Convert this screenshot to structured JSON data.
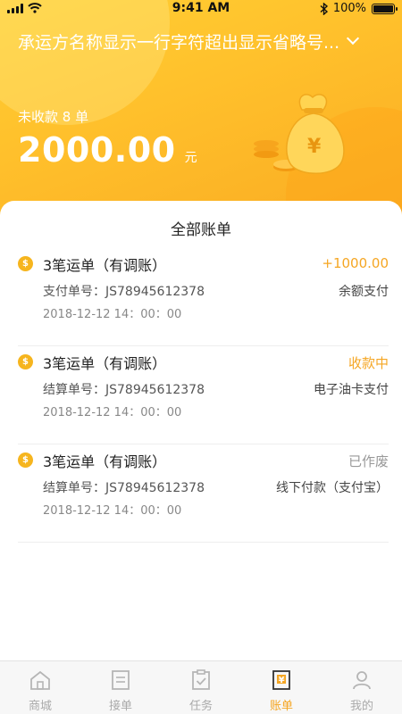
{
  "status_bar": {
    "time": "9:41 AM",
    "battery": "100%"
  },
  "header": {
    "carrier_name": "承运方名称显示一行字符超出显示省略号...",
    "unpaid_label": "未收款 8 单",
    "amount": "2000.00",
    "unit": "元"
  },
  "card_title": "全部账单",
  "bills": [
    {
      "title": "3笔运单（有调账）",
      "status": "+1000.00",
      "status_color": "#f5a623",
      "order_label": "支付单号：JS78945612378",
      "method": "余额支付",
      "date": "2018-12-12  14：00：00"
    },
    {
      "title": "3笔运单（有调账）",
      "status": "收款中",
      "status_color": "#f5a623",
      "order_label": "结算单号：JS78945612378",
      "method": "电子油卡支付",
      "date": "2018-12-12  14：00：00"
    },
    {
      "title": "3笔运单（有调账）",
      "status": "已作废",
      "status_color": "#999999",
      "order_label": "结算单号：JS78945612378",
      "method": "线下付款（支付宝）",
      "date": "2018-12-12  14：00：00"
    }
  ],
  "tabbar": {
    "items": [
      {
        "label": "商城",
        "icon": "home-icon"
      },
      {
        "label": "接单",
        "icon": "list-icon"
      },
      {
        "label": "任务",
        "icon": "clipboard-icon"
      },
      {
        "label": "账单",
        "icon": "bill-icon"
      },
      {
        "label": "我的",
        "icon": "user-icon"
      }
    ],
    "active": "账单"
  },
  "colors": {
    "accent": "#f5a623",
    "header_start": "#ffcf33",
    "header_end": "#f9ab22"
  }
}
